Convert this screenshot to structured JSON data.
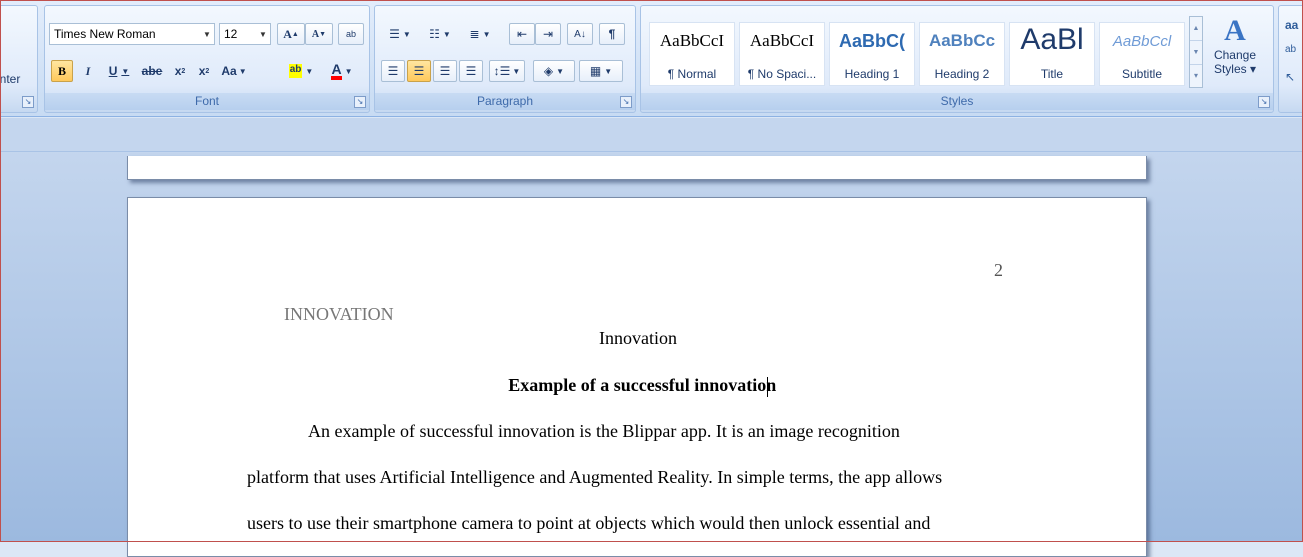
{
  "clipboard": {
    "format_painter_label": "inter"
  },
  "font": {
    "group_label": "Font",
    "font_name": "Times New Roman",
    "font_size": "12",
    "grow_label": "A",
    "shrink_label": "A",
    "clear_label": "ab",
    "bold_label": "B",
    "italic_label": "I",
    "underline_label": "U",
    "strike_label": "abe",
    "subscript_label": "x",
    "superscript_label": "x",
    "case_label": "Aa",
    "highlight_label": "ab",
    "color_label": "A"
  },
  "paragraph": {
    "group_label": "Paragraph",
    "pilcrow": "¶"
  },
  "styles": {
    "group_label": "Styles",
    "items": [
      {
        "sample": "AaBbCcI",
        "name": "¶ Normal"
      },
      {
        "sample": "AaBbCcI",
        "name": "¶ No Spaci..."
      },
      {
        "sample": "AaBbC(",
        "name": "Heading 1"
      },
      {
        "sample": "AaBbCc",
        "name": "Heading 2"
      },
      {
        "sample": "AaBl",
        "name": "Title"
      },
      {
        "sample": "AaBbCcl",
        "name": "Subtitle"
      }
    ],
    "change_styles_line1": "Change",
    "change_styles_line2": "Styles ▾"
  },
  "colors": {
    "accent": "#15428b",
    "highlight": "#ffff00",
    "font_color": "#ff0000",
    "heading_blue": "#4f81bd"
  },
  "document": {
    "page_number": "2",
    "running_head": "INNOVATION",
    "title": "Innovation",
    "heading": "Example of a successful innovation",
    "lines": [
      "An example of successful innovation is the Blippar app. It is an image recognition",
      "platform that uses Artificial Intelligence and Augmented Reality. In simple terms, the app allows",
      "users to use their smartphone camera to point at objects which would then unlock essential and"
    ]
  }
}
